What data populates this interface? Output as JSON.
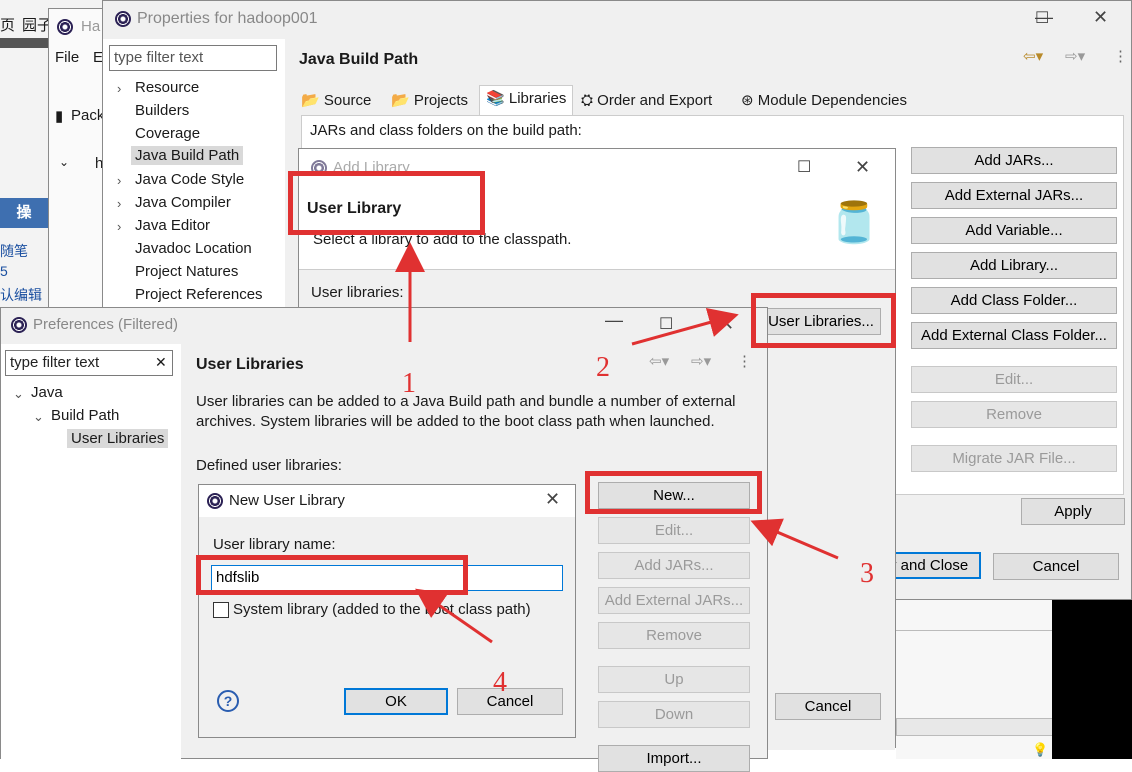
{
  "background_ide": {
    "menu": "File",
    "menu2": "E",
    "tab_partial": "Ha",
    "pack_partial": "Pack",
    "h_partial": "h",
    "cn_tab1": "页",
    "cn_tab2": "园子",
    "cn_side1": "操",
    "cn_side2": "随笔",
    "cn_side3": "认编辑"
  },
  "properties": {
    "title": "Properties for hadoop001",
    "filter_placeholder": "type filter text",
    "tree": [
      "Resource",
      "Builders",
      "Coverage",
      "Java Build Path",
      "Java Code Style",
      "Java Compiler",
      "Java Editor",
      "Javadoc Location",
      "Project Natures",
      "Project References"
    ],
    "section_title": "Java Build Path",
    "tabs": [
      "Source",
      "Projects",
      "Libraries",
      "Order and Export",
      "Module Dependencies"
    ],
    "jars_label": "JARs and class folders on the build path:",
    "buttons": [
      "Add JARs...",
      "Add External JARs...",
      "Add Variable...",
      "Add Library...",
      "Add Class Folder...",
      "Add External Class Folder...",
      "Edit...",
      "Remove",
      "Migrate JAR File..."
    ],
    "apply": "Apply",
    "apply_close": "y and Close",
    "cancel": "Cancel"
  },
  "add_library": {
    "title": "Add Library",
    "heading": "User Library",
    "desc": "Select a library to add to the classpath.",
    "user_libraries_label": "User libraries:",
    "user_libraries_button": "User Libraries...",
    "cancel": "Cancel"
  },
  "preferences": {
    "title": "Preferences (Filtered)",
    "filter_placeholder": "type filter text",
    "tree": [
      "Java",
      "Build Path",
      "User Libraries"
    ],
    "heading": "User Libraries",
    "desc": "User libraries can be added to a Java Build path and bundle a number of external archives. System libraries will be added to the boot class path when launched.",
    "defined_label": "Defined user libraries:",
    "buttons": [
      "New...",
      "Edit...",
      "Add JARs...",
      "Add External JARs...",
      "Remove",
      "Up",
      "Down",
      "Import..."
    ]
  },
  "new_user_library": {
    "title": "New User Library",
    "name_label": "User library name:",
    "name_value": "hdfslib",
    "system_checkbox": "System library (added to the boot class path)",
    "ok": "OK",
    "cancel": "Cancel",
    "help": "?"
  },
  "annotations": [
    "1",
    "2",
    "3",
    "4"
  ],
  "colors": {
    "annotation_red": "#e03131",
    "focus_blue": "#0078d7",
    "selected_gray": "#d9d9d9"
  }
}
